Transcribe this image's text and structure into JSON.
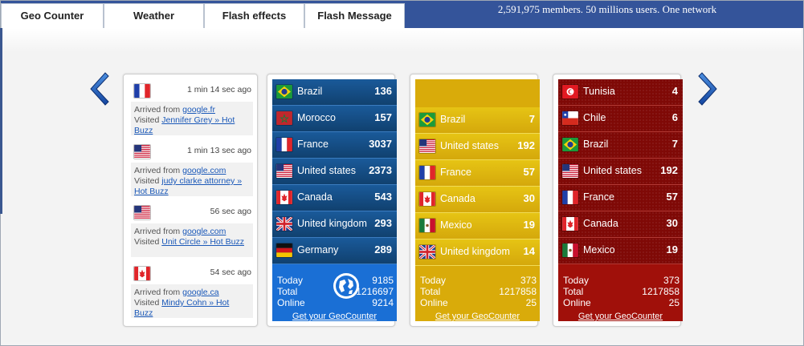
{
  "tabs": [
    {
      "label": "Geo Counter",
      "active": true
    },
    {
      "label": "Weather",
      "active": false
    },
    {
      "label": "Flash effects",
      "active": false
    },
    {
      "label": "Flash Message",
      "active": false
    }
  ],
  "tagline": "2,591,975 members. 50 millions users. One network",
  "nav": {
    "prev_icon": "chevron-left-icon",
    "next_icon": "chevron-right-icon"
  },
  "visitors": [
    {
      "flag": "france",
      "time": "1 min 14 sec ago",
      "arrived_label": "Arrived from",
      "source": "google.fr",
      "visited_label": "Visited",
      "page": "Jennifer Grey » Hot Buzz"
    },
    {
      "flag": "united-states",
      "time": "1 min 13 sec ago",
      "arrived_label": "Arrived from",
      "source": "google.com",
      "visited_label": "Visited",
      "page": "judy clarke attorney » Hot Buzz"
    },
    {
      "flag": "united-states",
      "time": "56 sec ago",
      "arrived_label": "Arrived from",
      "source": "google.com",
      "visited_label": "Visited",
      "page": "Unit Circle » Hot Buzz"
    },
    {
      "flag": "canada",
      "time": "54 sec ago",
      "arrived_label": "Arrived from",
      "source": "google.ca",
      "visited_label": "Visited",
      "page": "Mindy Cohn » Hot Buzz"
    }
  ],
  "panels": [
    {
      "theme": "blue",
      "rows": [
        {
          "flag": "brazil",
          "country": "Brazil",
          "count": "136"
        },
        {
          "flag": "morocco",
          "country": "Morocco",
          "count": "157"
        },
        {
          "flag": "france",
          "country": "France",
          "count": "3037"
        },
        {
          "flag": "united-states",
          "country": "United states",
          "count": "2373"
        },
        {
          "flag": "canada",
          "country": "Canada",
          "count": "543"
        },
        {
          "flag": "united-kingdom",
          "country": "United kingdom",
          "count": "293"
        },
        {
          "flag": "germany",
          "country": "Germany",
          "count": "289"
        }
      ],
      "stats": [
        {
          "label": "Today",
          "value": "9185"
        },
        {
          "label": "Total",
          "value": "1216697"
        },
        {
          "label": "Online",
          "value": "9214"
        }
      ],
      "link": "Get your GeoCounter"
    },
    {
      "theme": "yellow",
      "rows": [
        {
          "flag": "brazil",
          "country": "Brazil",
          "count": "7"
        },
        {
          "flag": "united-states",
          "country": "United states",
          "count": "192"
        },
        {
          "flag": "france",
          "country": "France",
          "count": "57"
        },
        {
          "flag": "canada",
          "country": "Canada",
          "count": "30"
        },
        {
          "flag": "mexico",
          "country": "Mexico",
          "count": "19"
        },
        {
          "flag": "united-kingdom",
          "country": "United kingdom",
          "count": "14"
        }
      ],
      "stats": [
        {
          "label": "Today",
          "value": "373"
        },
        {
          "label": "Total",
          "value": "1217858"
        },
        {
          "label": "Online",
          "value": "25"
        }
      ],
      "link": "Get your GeoCounter"
    },
    {
      "theme": "red",
      "rows": [
        {
          "flag": "tunisia",
          "country": "Tunisia",
          "count": "4"
        },
        {
          "flag": "chile",
          "country": "Chile",
          "count": "6"
        },
        {
          "flag": "brazil",
          "country": "Brazil",
          "count": "7"
        },
        {
          "flag": "united-states",
          "country": "United states",
          "count": "192"
        },
        {
          "flag": "france",
          "country": "France",
          "count": "57"
        },
        {
          "flag": "canada",
          "country": "Canada",
          "count": "30"
        },
        {
          "flag": "mexico",
          "country": "Mexico",
          "count": "19"
        }
      ],
      "stats": [
        {
          "label": "Today",
          "value": "373"
        },
        {
          "label": "Total",
          "value": "1217858"
        },
        {
          "label": "Online",
          "value": "25"
        }
      ],
      "link": "Get your GeoCounter"
    }
  ],
  "colors": {
    "topbar": "#34549a",
    "active_tab": "#1d3e78",
    "blue_panel": "#1a6fd5",
    "yellow_panel": "#d9ab0a",
    "red_panel": "#a0100a",
    "link": "#1a58b8"
  }
}
